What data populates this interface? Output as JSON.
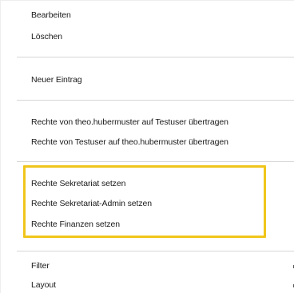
{
  "context_menu": {
    "items": [
      {
        "label": "Bearbeiten"
      },
      {
        "label": "Löschen"
      },
      {
        "label": "Neuer Eintrag"
      },
      {
        "label": "Rechte von theo.hubermuster auf Testuser übertragen"
      },
      {
        "label": "Rechte von Testuser auf theo.hubermuster übertragen"
      },
      {
        "label": "Rechte Sekretariat setzen"
      },
      {
        "label": "Rechte Sekretariat-Admin setzen"
      },
      {
        "label": "Rechte Finanzen setzen"
      },
      {
        "label": "Filter"
      },
      {
        "label": "Layout"
      }
    ]
  },
  "highlight": {
    "color": "#f0c51b"
  }
}
